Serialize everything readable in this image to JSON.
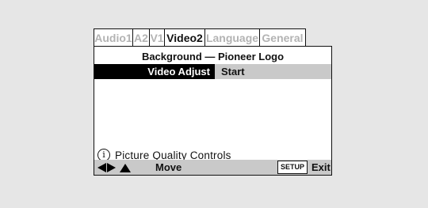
{
  "tabs": [
    {
      "label": "Audio1",
      "active": false
    },
    {
      "label": "A2",
      "active": false
    },
    {
      "label": "V1",
      "active": false
    },
    {
      "label": "Video2",
      "active": true
    },
    {
      "label": "Language",
      "active": false
    },
    {
      "label": "General",
      "active": false
    }
  ],
  "menu": {
    "background_row": "Background — Pioneer Logo",
    "video_adjust_label": "Video Adjust",
    "video_adjust_value": "Start"
  },
  "info": {
    "icon_glyph": "i",
    "text": "Picture Quality Controls"
  },
  "footer": {
    "arrow_icons": [
      "left-arrow-icon",
      "right-arrow-icon",
      "up-arrow-icon"
    ],
    "move_label": "Move",
    "setup_key_label": "SETUP",
    "exit_label": "Exit"
  },
  "colors": {
    "background": "#e6e6e6",
    "highlight": "#000000",
    "bar_gray": "#c9c9c9",
    "inactive_tab_text": "#b3b3b3"
  }
}
